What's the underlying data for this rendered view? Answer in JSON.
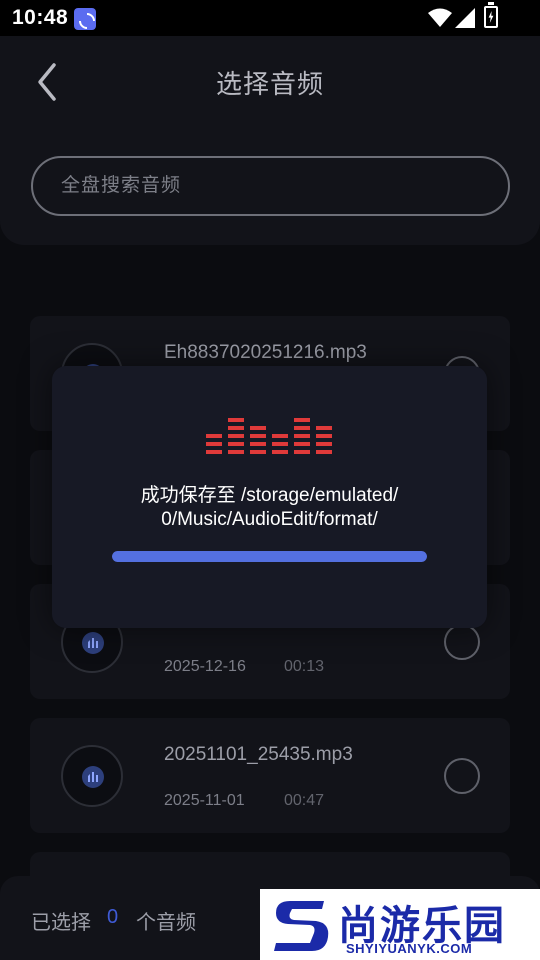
{
  "status_bar": {
    "time": "10:48",
    "app_icon": "pinwheel-app-icon",
    "wifi_icon": "wifi-icon",
    "signal_icon": "cell-signal-icon",
    "battery_icon": "battery-charging-icon"
  },
  "header": {
    "back_icon": "chevron-left-icon",
    "title": "选择音频"
  },
  "search": {
    "placeholder": "全盘搜索音频",
    "value": ""
  },
  "audio_list": [
    {
      "name": "Eh8837020251216.mp3",
      "date": "",
      "duration": ""
    },
    {
      "name": "",
      "date": "",
      "duration": ""
    },
    {
      "name": "",
      "date": "2025-12-16",
      "duration": "00:13"
    },
    {
      "name": "20251101_25435.mp3",
      "date": "2025-11-01",
      "duration": "00:47"
    },
    {
      "name": "",
      "date": "",
      "duration": ""
    }
  ],
  "bottom_bar": {
    "selected_label": "已选择",
    "selected_count": "0",
    "selected_unit": "个音频"
  },
  "modal": {
    "icon": "equalizer-icon",
    "message_line1": "成功保存至 /storage/emulated/",
    "message_line2": "0/Music/AudioEdit/format/",
    "progress": 1.0
  },
  "watermark": {
    "brand": "尚游乐园",
    "site": "SHYIYUANYK.COM"
  },
  "colors": {
    "background": "#0b0c10",
    "card": "#121319",
    "modal": "#171925",
    "accent": "#5470e0",
    "equalizer": "#e03a3a"
  }
}
